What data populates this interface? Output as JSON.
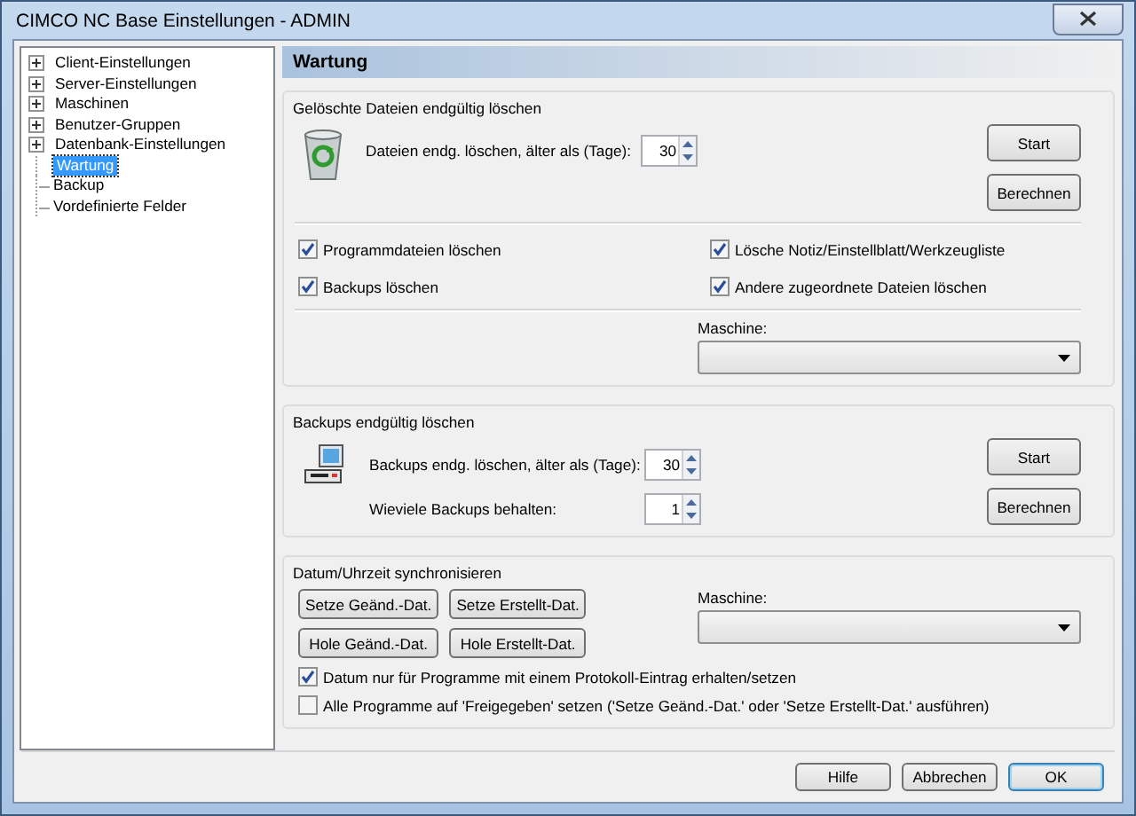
{
  "window": {
    "title": "CIMCO NC Base Einstellungen - ADMIN"
  },
  "tree": {
    "items": [
      {
        "label": "Client-Einstellungen",
        "expandable": true,
        "expanded": false,
        "selected": false
      },
      {
        "label": "Server-Einstellungen",
        "expandable": true,
        "expanded": false,
        "selected": false
      },
      {
        "label": "Maschinen",
        "expandable": true,
        "expanded": false,
        "selected": false
      },
      {
        "label": "Benutzer-Gruppen",
        "expandable": true,
        "expanded": false,
        "selected": false
      },
      {
        "label": "Datenbank-Einstellungen",
        "expandable": true,
        "expanded": false,
        "selected": false
      },
      {
        "label": "Wartung",
        "expandable": false,
        "selected": true
      },
      {
        "label": "Backup",
        "expandable": false,
        "selected": false
      },
      {
        "label": "Vordefinierte Felder",
        "expandable": false,
        "selected": false
      }
    ]
  },
  "page_title": "Wartung",
  "delete_files": {
    "title": "Gelöschte Dateien endgültig löschen",
    "spinners": [
      {
        "label": "Dateien endg. löschen, älter als (Tage):",
        "value": "30"
      }
    ],
    "buttons": [
      "Start",
      "Berechnen"
    ],
    "checkboxes": [
      {
        "label": "Programmdateien löschen",
        "checked": true
      },
      {
        "label": "Lösche Notiz/Einstellblatt/Werkzeugliste",
        "checked": true
      },
      {
        "label": "Backups löschen",
        "checked": true
      },
      {
        "label": "Andere zugeordnete Dateien löschen",
        "checked": true
      }
    ],
    "machine_label": "Maschine:"
  },
  "delete_backups": {
    "title": "Backups endgültig löschen",
    "spinners": [
      {
        "label": "Backups endg. löschen, älter als (Tage):",
        "value": "30"
      },
      {
        "label": "Wieviele Backups behalten:",
        "value": "1"
      }
    ],
    "buttons": [
      "Start",
      "Berechnen"
    ]
  },
  "sync": {
    "title": "Datum/Uhrzeit synchronisieren",
    "buttons": [
      "Setze Geänd.-Dat.",
      "Setze Erstellt-Dat.",
      "Hole Geänd.-Dat.",
      "Hole Erstellt-Dat."
    ],
    "machine_label": "Maschine:",
    "checkboxes": [
      {
        "label": "Datum nur für Programme mit einem Protokoll-Eintrag erhalten/setzen",
        "checked": true
      },
      {
        "label": "Alle Programme auf 'Freigegeben' setzen ('Setze Geänd.-Dat.' oder 'Setze Erstellt-Dat.' ausführen)",
        "checked": false
      }
    ]
  },
  "footer_buttons": [
    {
      "label": "Hilfe",
      "default": false
    },
    {
      "label": "Abbrechen",
      "default": false
    },
    {
      "label": "OK",
      "default": true
    }
  ]
}
